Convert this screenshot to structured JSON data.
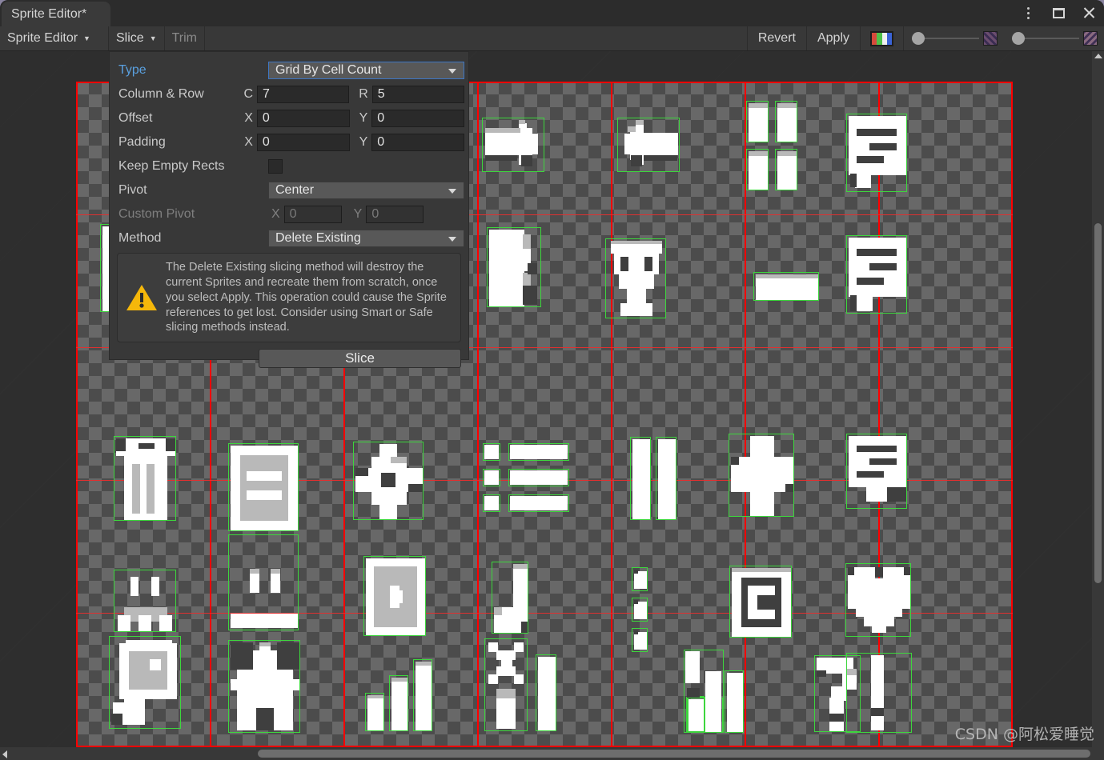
{
  "window": {
    "tab_title": "Sprite Editor*",
    "controls": {
      "menu": "kebab-menu",
      "maximize": "maximize",
      "close": "close"
    }
  },
  "toolbar": {
    "sprite_editor_label": "Sprite Editor",
    "slice_label": "Slice",
    "trim_label": "Trim",
    "revert_label": "Revert",
    "apply_label": "Apply",
    "rgb_swatch": "rgb-channel-icon",
    "slider_left_value": 0,
    "slider_right_value": 0
  },
  "slice_panel": {
    "type": {
      "label": "Type",
      "value": "Grid By Cell Count"
    },
    "column_row": {
      "label": "Column & Row",
      "c_prefix": "C",
      "c_value": "7",
      "r_prefix": "R",
      "r_value": "5"
    },
    "offset": {
      "label": "Offset",
      "x_prefix": "X",
      "x_value": "0",
      "y_prefix": "Y",
      "y_value": "0"
    },
    "padding": {
      "label": "Padding",
      "x_prefix": "X",
      "x_value": "0",
      "y_prefix": "Y",
      "y_value": "0"
    },
    "keep_empty_rects": {
      "label": "Keep Empty Rects",
      "checked": false
    },
    "pivot": {
      "label": "Pivot",
      "value": "Center"
    },
    "custom_pivot": {
      "label": "Custom Pivot",
      "x_prefix": "X",
      "x_value": "0",
      "y_prefix": "Y",
      "y_value": "0",
      "enabled": false
    },
    "method": {
      "label": "Method",
      "value": "Delete Existing"
    },
    "warning": {
      "icon": "warning-triangle-icon",
      "text": "The Delete Existing slicing method will destroy the current Sprites and recreate them from scratch, once you select Apply. This operation could cause the Sprite references to get lost. Consider using Smart or Safe slicing methods instead."
    },
    "slice_button_label": "Slice"
  },
  "sprite_sheet": {
    "columns": 7,
    "rows": 5,
    "grid_color": "#ff0000",
    "selection_color": "#3dd63d",
    "checker_light": "#686868",
    "checker_dark": "#4c4c4c",
    "sprites": [
      {
        "row": 0,
        "col": 0,
        "name": "sprite-bar-vertical"
      },
      {
        "row": 0,
        "col": 1,
        "name": "sprite-bars-pair"
      },
      {
        "row": 0,
        "col": 2,
        "name": "sprite-arrow-right"
      },
      {
        "row": 0,
        "col": 3,
        "name": "sprite-arrow-left"
      },
      {
        "row": 0,
        "col": 4,
        "name": "sprite-grid-four"
      },
      {
        "row": 0,
        "col": 5,
        "name": "sprite-speech-bubble"
      },
      {
        "row": 1,
        "col": 0,
        "name": "sprite-bar-tall"
      },
      {
        "row": 1,
        "col": 2,
        "name": "sprite-arrow-shape"
      },
      {
        "row": 1,
        "col": 3,
        "name": "sprite-trophy"
      },
      {
        "row": 1,
        "col": 4,
        "name": "sprite-rectangle"
      },
      {
        "row": 1,
        "col": 5,
        "name": "sprite-speech-bubble-2"
      },
      {
        "row": 2,
        "col": 0,
        "name": "sprite-trash-can"
      },
      {
        "row": 2,
        "col": 1,
        "name": "sprite-document"
      },
      {
        "row": 2,
        "col": 2,
        "name": "sprite-compass"
      },
      {
        "row": 2,
        "col": 3,
        "name": "sprite-list"
      },
      {
        "row": 2,
        "col": 4,
        "name": "sprite-pause"
      },
      {
        "row": 2,
        "col": 5,
        "name": "sprite-plus"
      },
      {
        "row": 2,
        "col": 6,
        "name": "sprite-speech-bubble-3"
      },
      {
        "row": 3,
        "col": 0,
        "name": "sprite-sad-face"
      },
      {
        "row": 3,
        "col": 1,
        "name": "sprite-neutral-face"
      },
      {
        "row": 3,
        "col": 2,
        "name": "sprite-play-frame"
      },
      {
        "row": 3,
        "col": 3,
        "name": "sprite-note"
      },
      {
        "row": 3,
        "col": 4,
        "name": "sprite-dots-vertical"
      },
      {
        "row": 3,
        "col": 5,
        "name": "sprite-bracket"
      },
      {
        "row": 3,
        "col": 6,
        "name": "sprite-heart"
      },
      {
        "row": 4,
        "col": 0,
        "name": "sprite-magnifier"
      },
      {
        "row": 4,
        "col": 1,
        "name": "sprite-home"
      },
      {
        "row": 4,
        "col": 2,
        "name": "sprite-bar-chart"
      },
      {
        "row": 4,
        "col": 3,
        "name": "sprite-chart-x"
      },
      {
        "row": 4,
        "col": 4,
        "name": "sprite-chart-bars"
      },
      {
        "row": 4,
        "col": 5,
        "name": "sprite-question-mark"
      },
      {
        "row": 4,
        "col": 6,
        "name": "sprite-exclamation-mark"
      }
    ]
  },
  "scrollbars": {
    "vertical": "vertical-scrollbar",
    "horizontal": "horizontal-scrollbar"
  },
  "watermark": "CSDN @阿松爱睡觉"
}
